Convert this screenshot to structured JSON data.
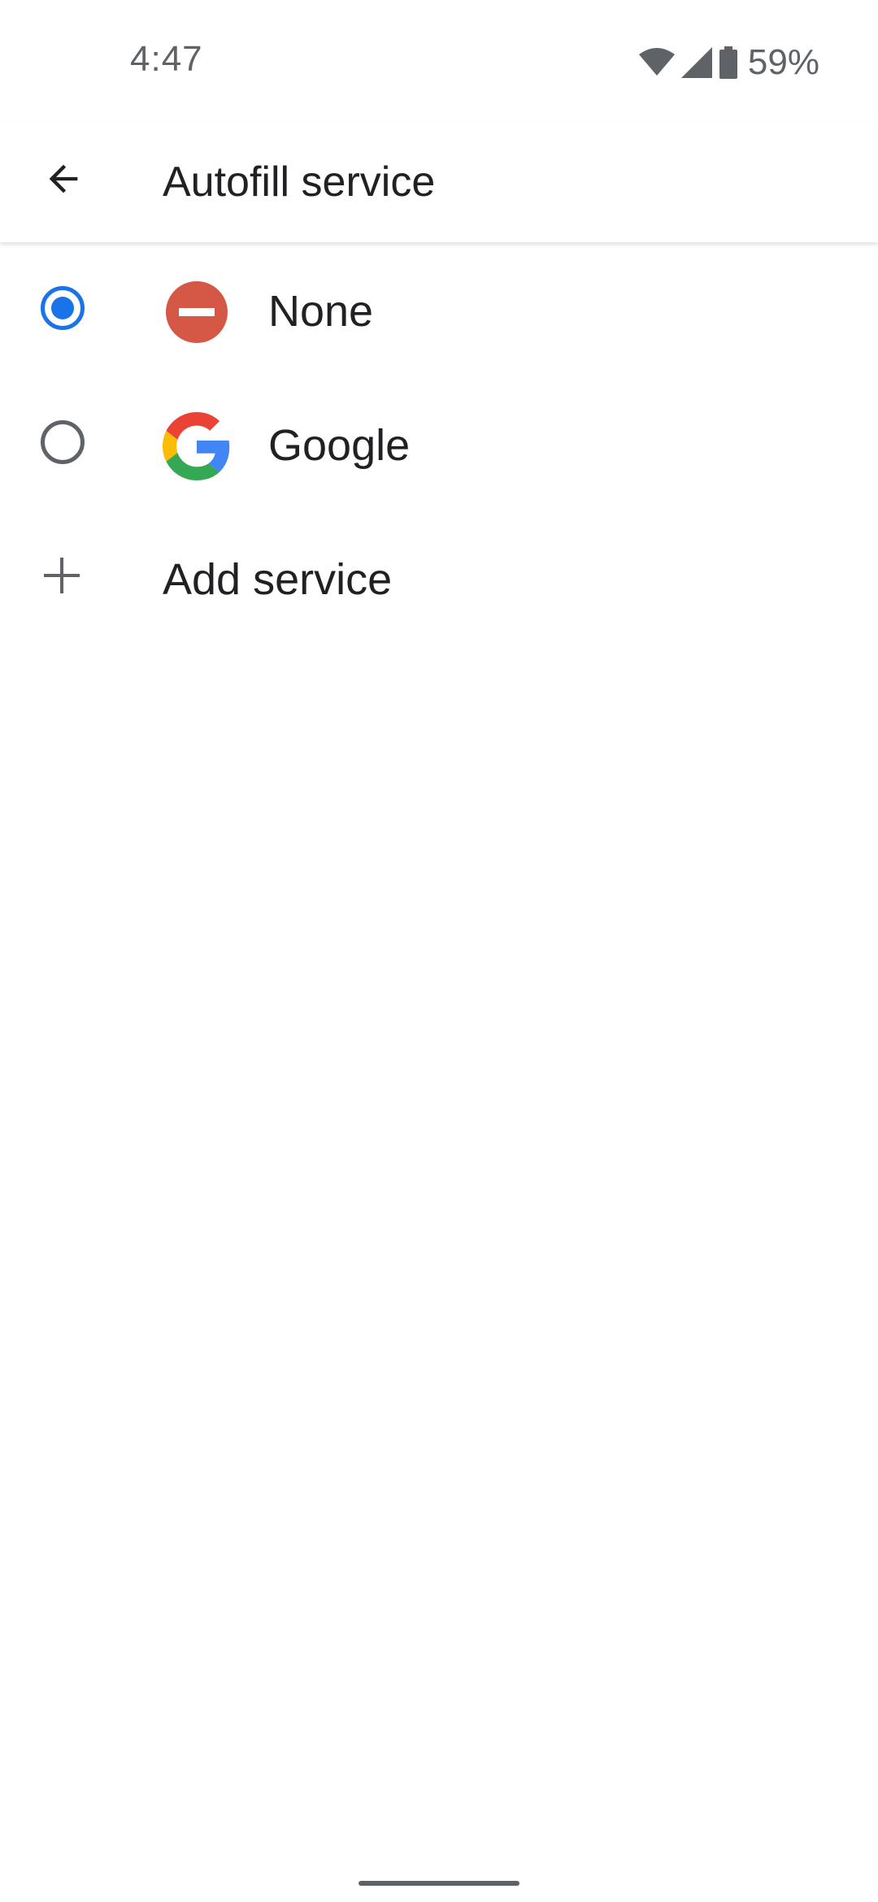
{
  "status_bar": {
    "time": "4:47",
    "battery": "59%",
    "icons": [
      "wifi-icon",
      "signal-icon",
      "battery-icon"
    ]
  },
  "app_bar": {
    "title": "Autofill service",
    "back_icon": "arrow-back-icon"
  },
  "services": [
    {
      "label": "None",
      "selected": true,
      "icon": "none-icon"
    },
    {
      "label": "Google",
      "selected": false,
      "icon": "google-icon"
    }
  ],
  "add_service": {
    "label": "Add service",
    "icon": "plus-icon"
  },
  "colors": {
    "accent": "#1a73e8",
    "none_red": "#d55745",
    "text": "#202124",
    "secondary": "#5f6368"
  }
}
